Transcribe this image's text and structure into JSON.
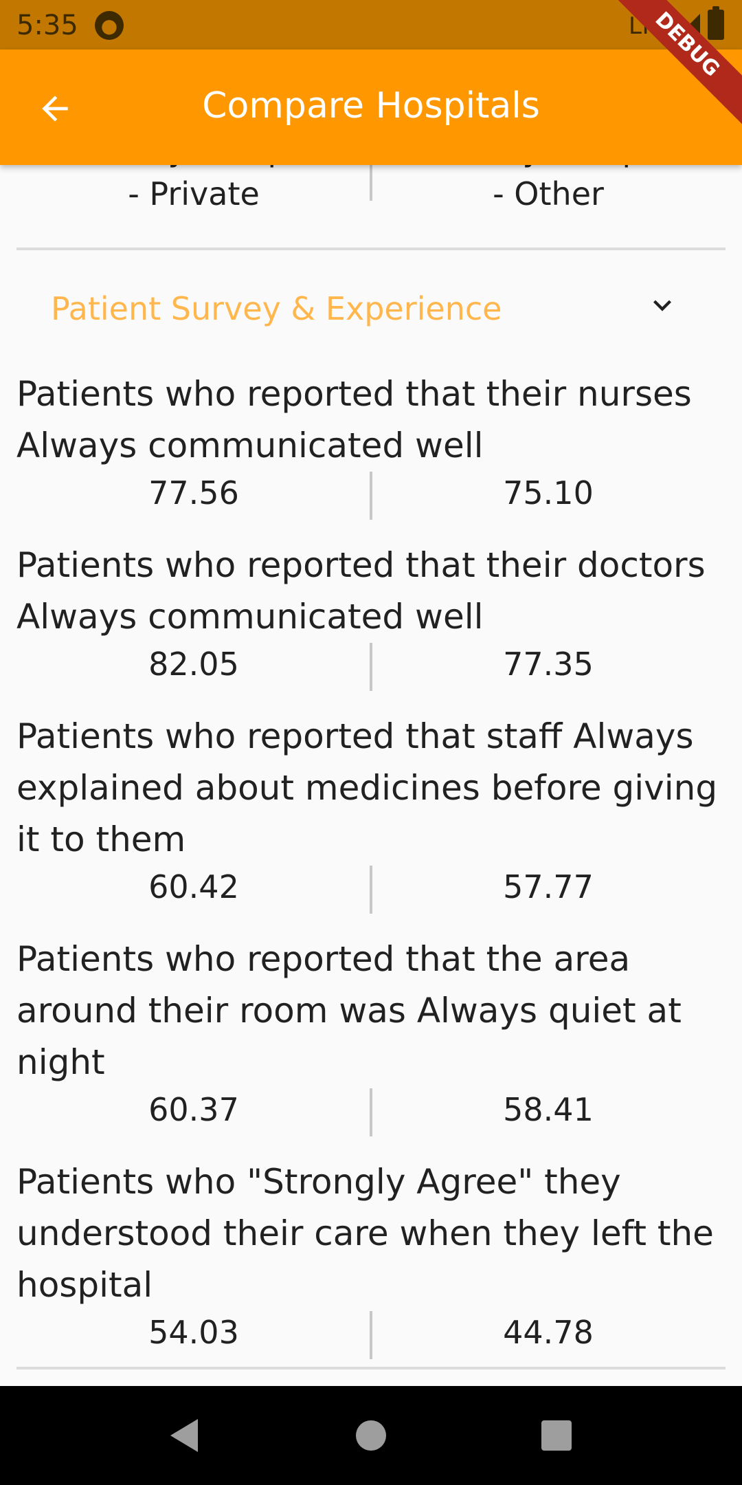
{
  "status": {
    "time": "5:35",
    "network": "LTE"
  },
  "appbar": {
    "title": "Compare Hospitals",
    "debug": "DEBUG"
  },
  "partial": {
    "left_line1": "Voluntary non-profit",
    "left_line2": "- Private",
    "right_line1": "Voluntary non-profit",
    "right_line2": "- Other"
  },
  "section": {
    "title": "Patient Survey & Experience"
  },
  "metrics": [
    {
      "label": "Patients who reported that their nurses Always communicated well",
      "left": "77.56",
      "right": "75.10"
    },
    {
      "label": "Patients who reported that their doctors Always communicated well",
      "left": "82.05",
      "right": "77.35"
    },
    {
      "label": "Patients who reported that staff Always explained about medicines before giving it to them",
      "left": "60.42",
      "right": "57.77"
    },
    {
      "label": "Patients who reported that the area around their room was Always quiet at night",
      "left": "60.37",
      "right": "58.41"
    },
    {
      "label": "Patients who \"Strongly Agree\" they understood their care when they left the hospital",
      "left": "54.03",
      "right": "44.78"
    }
  ],
  "colors": {
    "appbar": "#ff9800",
    "statusbar": "#c17700",
    "section_title": "#ffb74d",
    "debug_banner": "#b0291b"
  }
}
